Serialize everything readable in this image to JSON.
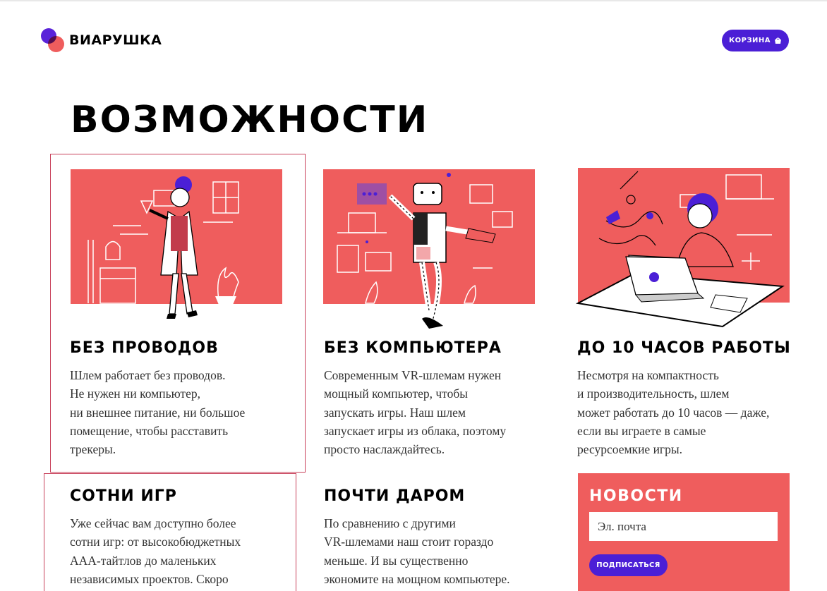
{
  "brand": {
    "name": "ВИАРУШКА"
  },
  "header": {
    "cart_label": "КОРЗИНА"
  },
  "page": {
    "title": "ВОЗМОЖНОСТИ"
  },
  "features": [
    {
      "title": "БЕЗ ПРОВОДОВ",
      "text": "Шлем работает без проводов.\nНе нужен ни компьютер,\nни внешнее питание, ни большое\nпомещение, чтобы расставить\nтрекеры."
    },
    {
      "title": "БЕЗ КОМПЬЮТЕРА",
      "text": "Современным VR-шлемам нужен\nмощный компьютер, чтобы\nзапускать игры. Наш шлем\nзапускает игры из облака, поэтому\nпросто наслаждайтесь."
    },
    {
      "title": "ДО 10 ЧАСОВ РАБОТЫ",
      "text": "Несмотря на компактность\nи производительность, шлем\nможет работать до 10 часов — даже,\nесли вы играете в самые\nресурсоемкие игры."
    },
    {
      "title": "СОТНИ ИГР",
      "text": "Уже сейчас вам доступно более\nсотни игр: от высокобюджетных\nААА-тайтлов до маленьких\nнезависимых проектов. Скоро"
    },
    {
      "title": "ПОЧТИ ДАРОМ",
      "text": "По сравнению с другими\nVR-шлемами наш стоит гораздо\nменьше. И вы существенно\nэкономите на мощном компьютере."
    }
  ],
  "newsletter": {
    "title": "НОВОСТИ",
    "email_placeholder": "Эл. почта",
    "subscribe_label": "ПОДПИСАТЬСЯ"
  },
  "colors": {
    "accent_red": "#ef5d5d",
    "accent_purple": "#4b1fd6",
    "frame": "#c8405a"
  }
}
